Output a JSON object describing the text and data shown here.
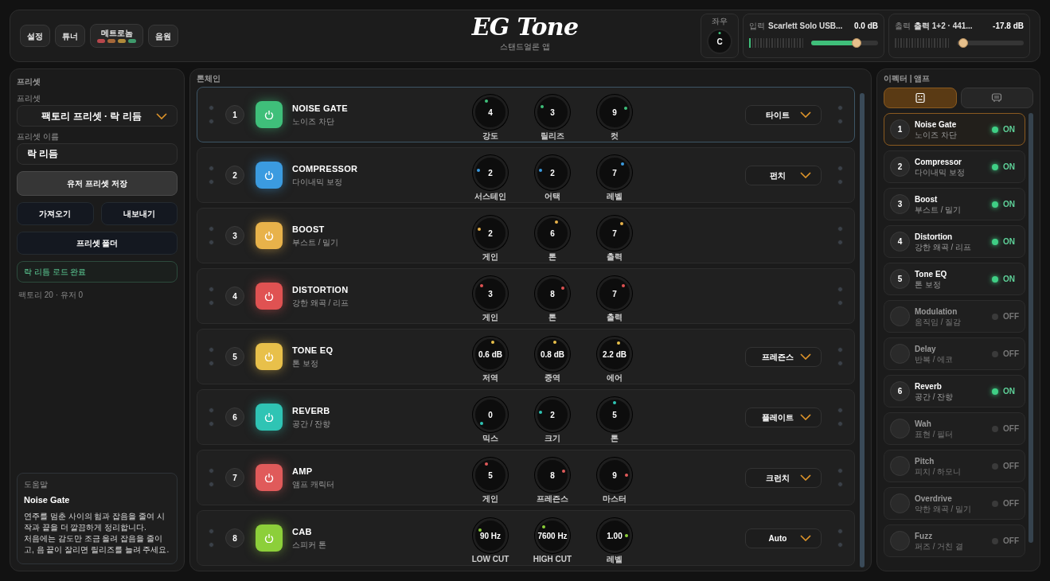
{
  "header": {
    "buttons": [
      {
        "label": "설정"
      },
      {
        "label": "튜너"
      },
      {
        "label": "메트로놈",
        "lights": [
          {
            "color": "#b8474c"
          },
          {
            "color": "#a5683a"
          },
          {
            "color": "#b08a3a"
          },
          {
            "color": "#3f9a6c"
          }
        ]
      },
      {
        "label": "음원"
      }
    ],
    "logo": "EG Tone",
    "subtitle": "스탠드얼론 앱",
    "pan": {
      "label": "좌우",
      "value": "C"
    },
    "input": {
      "label": "입력",
      "device": "Scarlett Solo USB...",
      "reading": "0.0 dB",
      "slider": {
        "level": 0.68
      }
    },
    "output": {
      "label": "출력",
      "device": "출력 1+2 · 441...",
      "reading": "-17.8 dB",
      "slider": {
        "level": 0.1
      }
    }
  },
  "preset_panel": {
    "title": "프리셋",
    "preset_label": "프리셋",
    "preset_value": "팩토리 프리셋 · 락 리듬",
    "name_label": "프리셋 이름",
    "name_value": "락 리듬",
    "save_button": "유저 프리셋 저장",
    "import_button": "가져오기",
    "export_button": "내보내기",
    "folder_button": "프리셋 폴더",
    "status": "락 리듬 로드 완료",
    "count": "팩토리 20 · 유저 0",
    "help": {
      "title": "도움말",
      "heading": "Noise Gate",
      "lines": [
        "연주를 멈춘 사이의 험과 잡음을 줄여 시작과 끝을 더 깔끔하게 정리합니다.",
        "처음에는 감도만 조금 올려 잡음을 줄이고, 음 끝이 잘리면 릴리즈를 늘려 주세요."
      ]
    }
  },
  "chain": {
    "title": "톤체인",
    "slots": [
      {
        "number": "1",
        "name": "NOISE GATE",
        "sub": "노이즈 차단",
        "color": "#3fbf7a",
        "selected": true,
        "mode": "타이트",
        "knobs": [
          {
            "value": "4",
            "label": "강도"
          },
          {
            "value": "3",
            "label": "릴리즈"
          },
          {
            "value": "9",
            "label": "컷"
          }
        ]
      },
      {
        "number": "2",
        "name": "COMPRESSOR",
        "sub": "다이내믹 보정",
        "color": "#3b9be0",
        "selected": false,
        "mode": "펀치",
        "knobs": [
          {
            "value": "2",
            "label": "서스테인"
          },
          {
            "value": "2",
            "label": "어택"
          },
          {
            "value": "7",
            "label": "레벨"
          }
        ]
      },
      {
        "number": "3",
        "name": "BOOST",
        "sub": "부스트 / 밀기",
        "color": "#e8b24a",
        "selected": false,
        "knobs": [
          {
            "value": "2",
            "label": "게인"
          },
          {
            "value": "6",
            "label": "톤"
          },
          {
            "value": "7",
            "label": "출력"
          }
        ]
      },
      {
        "number": "4",
        "name": "DISTORTION",
        "sub": "강한 왜곡 / 리프",
        "color": "#e05252",
        "selected": false,
        "knobs": [
          {
            "value": "3",
            "label": "게인"
          },
          {
            "value": "8",
            "label": "톤"
          },
          {
            "value": "7",
            "label": "출력"
          }
        ]
      },
      {
        "number": "5",
        "name": "TONE EQ",
        "sub": "톤 보정",
        "color": "#e8c04a",
        "selected": false,
        "mode": "프레즌스",
        "knobs": [
          {
            "value": "0.6 dB",
            "label": "저역"
          },
          {
            "value": "0.8 dB",
            "label": "중역"
          },
          {
            "value": "2.2 dB",
            "label": "에어"
          }
        ]
      },
      {
        "number": "6",
        "name": "REVERB",
        "sub": "공간 / 잔향",
        "color": "#2fc4b4",
        "selected": false,
        "mode": "플레이트",
        "knobs": [
          {
            "value": "0",
            "label": "믹스"
          },
          {
            "value": "2",
            "label": "크기"
          },
          {
            "value": "5",
            "label": "톤"
          }
        ]
      },
      {
        "number": "7",
        "name": "AMP",
        "sub": "앰프 캐릭터",
        "color": "#e05a5a",
        "selected": false,
        "mode": "크런치",
        "knobs": [
          {
            "value": "5",
            "label": "게인"
          },
          {
            "value": "8",
            "label": "프레즌스"
          },
          {
            "value": "9",
            "label": "마스터"
          }
        ]
      },
      {
        "number": "8",
        "name": "CAB",
        "sub": "스피커 톤",
        "color": "#8ccf3a",
        "selected": false,
        "mode": "Auto",
        "knobs": [
          {
            "value": "90 Hz",
            "label": "LOW CUT"
          },
          {
            "value": "7600 Hz",
            "label": "HIGH CUT"
          },
          {
            "value": "1.00",
            "label": "레벨"
          }
        ]
      }
    ]
  },
  "effects_panel": {
    "title": "이펙터 | 앰프",
    "tabs": [
      {
        "kind": "pedal",
        "selected": true
      },
      {
        "kind": "amp",
        "selected": false
      }
    ],
    "items": [
      {
        "number": "1",
        "name": "Noise Gate",
        "sub": "노이즈 차단",
        "on": true,
        "state": "ON",
        "selected": true
      },
      {
        "number": "2",
        "name": "Compressor",
        "sub": "다이내믹 보정",
        "on": true,
        "state": "ON",
        "selected": false
      },
      {
        "number": "3",
        "name": "Boost",
        "sub": "부스트 / 밀기",
        "on": true,
        "state": "ON",
        "selected": false
      },
      {
        "number": "4",
        "name": "Distortion",
        "sub": "강한 왜곡 / 리프",
        "on": true,
        "state": "ON",
        "selected": false
      },
      {
        "number": "5",
        "name": "Tone EQ",
        "sub": "톤 보정",
        "on": true,
        "state": "ON",
        "selected": false
      },
      {
        "name": "Modulation",
        "sub": "움직임 / 질감",
        "on": false,
        "state": "OFF",
        "selected": false
      },
      {
        "name": "Delay",
        "sub": "반복 / 에코",
        "on": false,
        "state": "OFF",
        "selected": false
      },
      {
        "number": "6",
        "name": "Reverb",
        "sub": "공간 / 잔향",
        "on": true,
        "state": "ON",
        "selected": false
      },
      {
        "name": "Wah",
        "sub": "표현 / 필터",
        "on": false,
        "state": "OFF",
        "selected": false
      },
      {
        "name": "Pitch",
        "sub": "피치 / 하모니",
        "on": false,
        "state": "OFF",
        "selected": false
      },
      {
        "name": "Overdrive",
        "sub": "약한 왜곡 / 밀기",
        "on": false,
        "state": "OFF",
        "selected": false
      },
      {
        "name": "Fuzz",
        "sub": "퍼즈 / 거친 결",
        "on": false,
        "state": "OFF",
        "selected": false
      }
    ]
  }
}
